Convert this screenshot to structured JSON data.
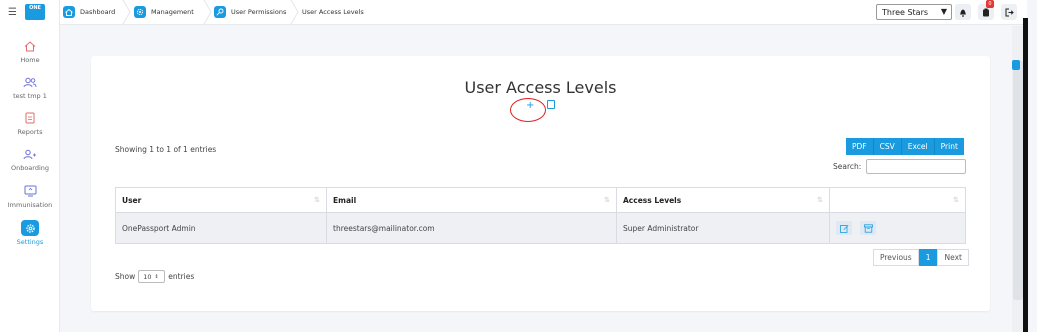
{
  "logo": {
    "text": "ONE"
  },
  "sidebar": {
    "items": [
      {
        "label": "Home",
        "icon": "home-icon"
      },
      {
        "label": "test tmp 1",
        "icon": "users-icon"
      },
      {
        "label": "Reports",
        "icon": "report-icon"
      },
      {
        "label": "Onboarding",
        "icon": "user-add-icon"
      },
      {
        "label": "Immunisation",
        "icon": "monitor-icon"
      },
      {
        "label": "Settings",
        "icon": "gear-icon",
        "active": true
      }
    ]
  },
  "breadcrumb": {
    "items": [
      {
        "label": "Dashboard",
        "icon": "home-icon"
      },
      {
        "label": "Management",
        "icon": "gear-icon"
      },
      {
        "label": "User Permissions",
        "icon": "key-icon"
      },
      {
        "label": "User Access Levels"
      }
    ]
  },
  "header": {
    "store_selected": "Three Stars",
    "notification_count": "0"
  },
  "page": {
    "title": "User Access Levels",
    "add_symbol": "+",
    "showing_text": "Showing 1 to 1 of 1 entries",
    "export_buttons": [
      "PDF",
      "CSV",
      "Excel",
      "Print"
    ],
    "search_label": "Search:",
    "search_value": "",
    "table": {
      "columns": [
        "User",
        "Email",
        "Access Levels",
        ""
      ],
      "rows": [
        {
          "user": "OnePassport Admin",
          "email": "threestars@mailinator.com",
          "access_level": "Super Administrator"
        }
      ]
    },
    "pagination": {
      "previous": "Previous",
      "current": "1",
      "next": "Next"
    },
    "length": {
      "prefix": "Show",
      "value": "10",
      "suffix": "entries"
    }
  },
  "colors": {
    "accent": "#1a9be0",
    "highlight": "#e02020"
  }
}
